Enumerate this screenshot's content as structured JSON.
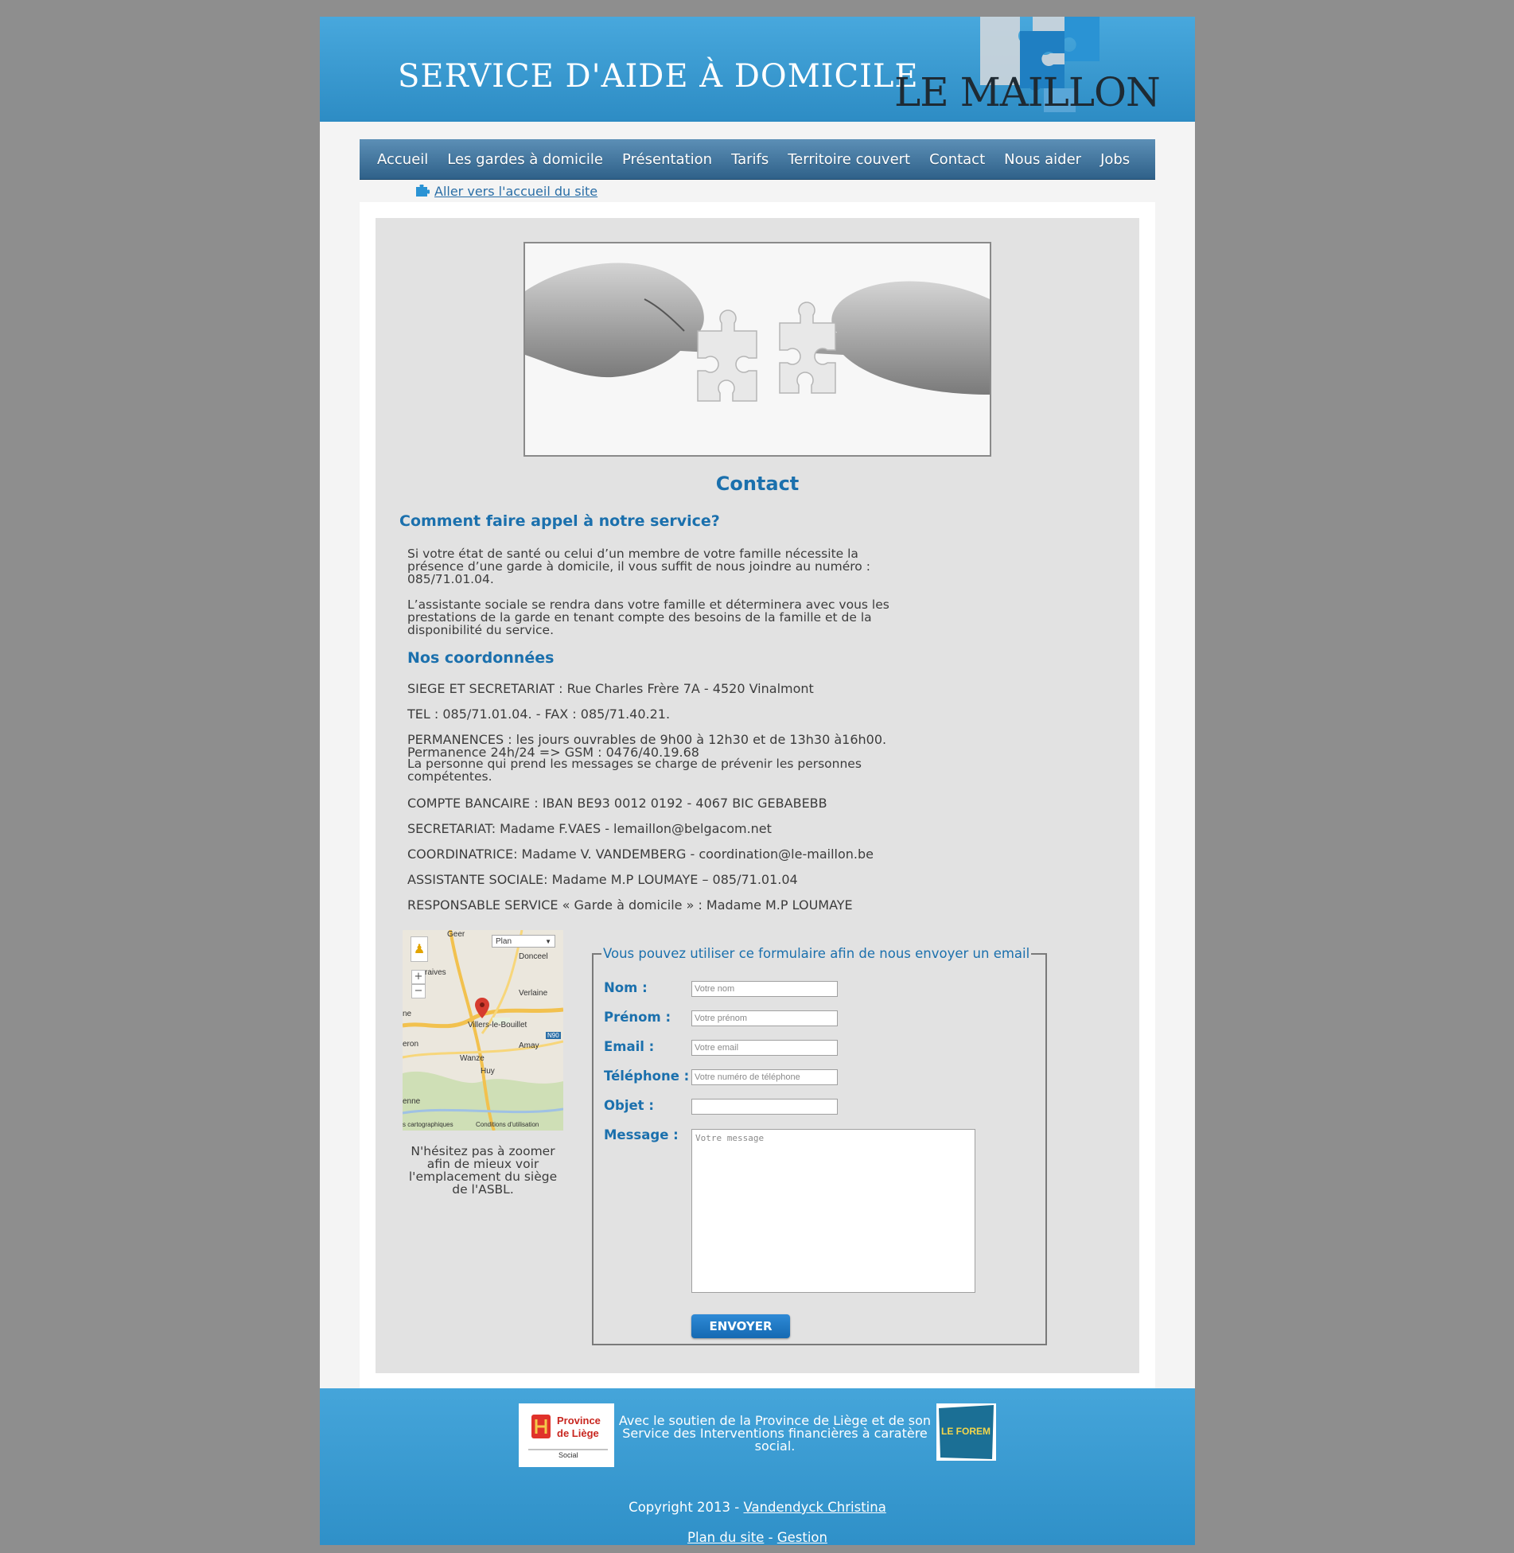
{
  "header": {
    "site_title": "SERVICE D'AIDE À DOMICILE",
    "logo_text": "LE MAILLON"
  },
  "nav": {
    "items": [
      "Accueil",
      "Les gardes à domicile",
      "Présentation",
      "Tarifs",
      "Territoire couvert",
      "Contact",
      "Nous aider",
      "Jobs"
    ]
  },
  "home_link": "Aller vers l'accueil du site",
  "page": {
    "title": "Contact",
    "appeal_title": "Comment faire appel à notre service?",
    "appeal_p1": "Si votre état de santé ou celui d’un membre de votre famille nécessite la présence d’une garde à domicile, il vous suffit de nous joindre au numéro : 085/71.01.04.",
    "appeal_p2": "L’assistante sociale se rendra dans votre famille et déterminera avec vous les prestations de la garde en tenant compte des besoins de la famille et de la disponibilité du service.",
    "coord_title": "Nos coordonnées",
    "siege": "SIEGE ET SECRETARIAT : Rue Charles Frère 7A - 4520 Vinalmont",
    "tel": "TEL : 085/71.01.04. - FAX : 085/71.40.21.",
    "permanences": "PERMANENCES : les jours ouvrables de 9h00 à 12h30 et de 13h30 à16h00.",
    "permanence_gsm": "Permanence 24h/24 => GSM : 0476/40.19.68",
    "permanence_note": "La personne qui prend les messages se charge de prévenir les personnes compétentes.",
    "compte": "COMPTE BANCAIRE : IBAN BE93 0012 0192 - 4067 BIC GEBABEBB",
    "secretariat": "SECRETARIAT: Madame F.VAES - lemaillon@belgacom.net",
    "coordinatrice": "COORDINATRICE: Madame V. VANDEMBERG - coordination@le-maillon.be",
    "assistante": "ASSISTANTE SOCIALE: Madame M.P LOUMAYE – 085/71.01.04",
    "responsable": "RESPONSABLE SERVICE « Garde à domicile » : Madame M.P LOUMAYE"
  },
  "map": {
    "type_selector": "Plan",
    "zoom_in": "+",
    "zoom_out": "−",
    "labels": [
      "Geer",
      "Donceel",
      "raives",
      "Verlaine",
      "ne",
      "Villers-le-Bouillet",
      "N90",
      "eron",
      "Amay",
      "Wanze",
      "Huy",
      "enne"
    ],
    "attribution": "s cartographiques",
    "terms": "Conditions d'utilisation",
    "caption": "N'hésitez pas à zoomer afin de mieux voir l'emplacement du siège de l'ASBL."
  },
  "form": {
    "legend": "Vous pouvez utiliser ce formulaire afin de nous envoyer un email",
    "nom_label": "Nom :",
    "nom_placeholder": "Votre nom",
    "prenom_label": "Prénom :",
    "prenom_placeholder": "Votre prénom",
    "email_label": "Email :",
    "email_placeholder": "Votre email",
    "tel_label": "Téléphone :",
    "tel_placeholder": "Votre numéro de téléphone",
    "objet_label": "Objet :",
    "objet_placeholder": "",
    "message_label": "Message :",
    "message_placeholder": "Votre message",
    "send_label": "ENVOYER"
  },
  "footer": {
    "province_logo_line1": "Province",
    "province_logo_line2": "de Liège",
    "province_logo_line3": "Social",
    "forem_logo": "LE FOREM",
    "support_text": "Avec le soutien de la Province de Liège et de son Service des Interventions financières à caratère social.",
    "copyright_prefix": "Copyright 2013 - ",
    "copyright_author": "Vandendyck Christina",
    "plan_du_site": "Plan du site",
    "separator": " - ",
    "gestion": "Gestion"
  },
  "colors": {
    "accent_blue": "#1b70ad",
    "header_blue": "#48a8dd",
    "nav_blue": "#2f6189",
    "page_bg": "#8e8e8e"
  }
}
